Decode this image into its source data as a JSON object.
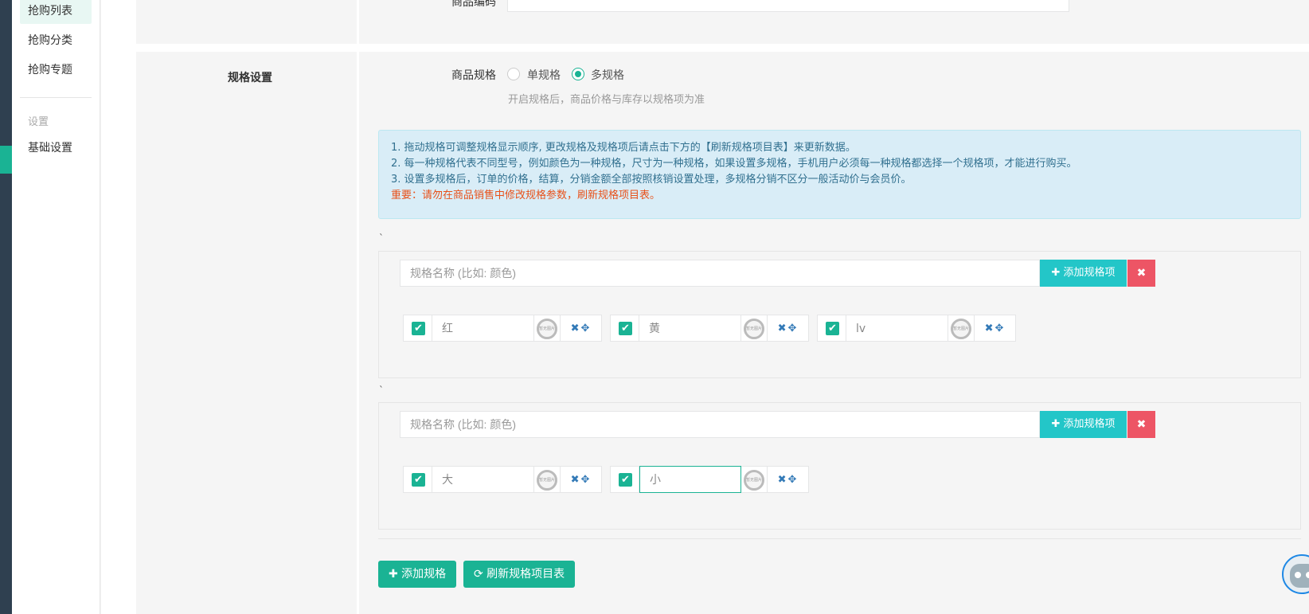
{
  "sidebar": {
    "items": [
      {
        "label": "抢购列表"
      },
      {
        "label": "抢购分类"
      },
      {
        "label": "抢购专题"
      }
    ],
    "group_label": "设置",
    "settings_item": "基础设置"
  },
  "top_section": {
    "field_label": "商品编码"
  },
  "spec_section": {
    "title": "规格设置",
    "field_label": "商品规格",
    "radio_single": "单规格",
    "radio_multi": "多规格",
    "selected": "多规格",
    "help": "开启规格后，商品价格与库存以规格项为准",
    "notice": {
      "line1": "1. 拖动规格可调整规格显示顺序, 更改规格及规格项后请点击下方的【刷新规格项目表】来更新数据。",
      "line2": "2. 每一种规格代表不同型号，例如颜色为一种规格，尺寸为一种规格，如果设置多规格，手机用户必须每一种规格都选择一个规格项，才能进行购买。",
      "line3": "3. 设置多规格后，订单的价格，结算，分销金额全部按照核销设置处理，多规格分销不区分一般活动价与会员价。",
      "important": "重要：请勿在商品销售中修改规格参数，刷新规格项目表。"
    },
    "tick_mark": "`",
    "name_placeholder": "规格名称 (比如: 颜色)",
    "add_item_label": "✚ 添加规格项",
    "delete_icon": "✖",
    "no_image_text": "暂无图片",
    "item_actions": "✖✥",
    "specs": [
      {
        "items": [
          {
            "value": "红"
          },
          {
            "value": "黄"
          },
          {
            "value": "lv"
          }
        ]
      },
      {
        "items": [
          {
            "value": "大"
          },
          {
            "value": "小"
          }
        ]
      }
    ],
    "add_spec_button": "✚ 添加规格",
    "refresh_button": "⟳ 刷新规格项目表"
  },
  "colors": {
    "primary": "#1ab394",
    "info": "#23c6c8",
    "danger": "#ed5565",
    "important": "#e8511a"
  }
}
